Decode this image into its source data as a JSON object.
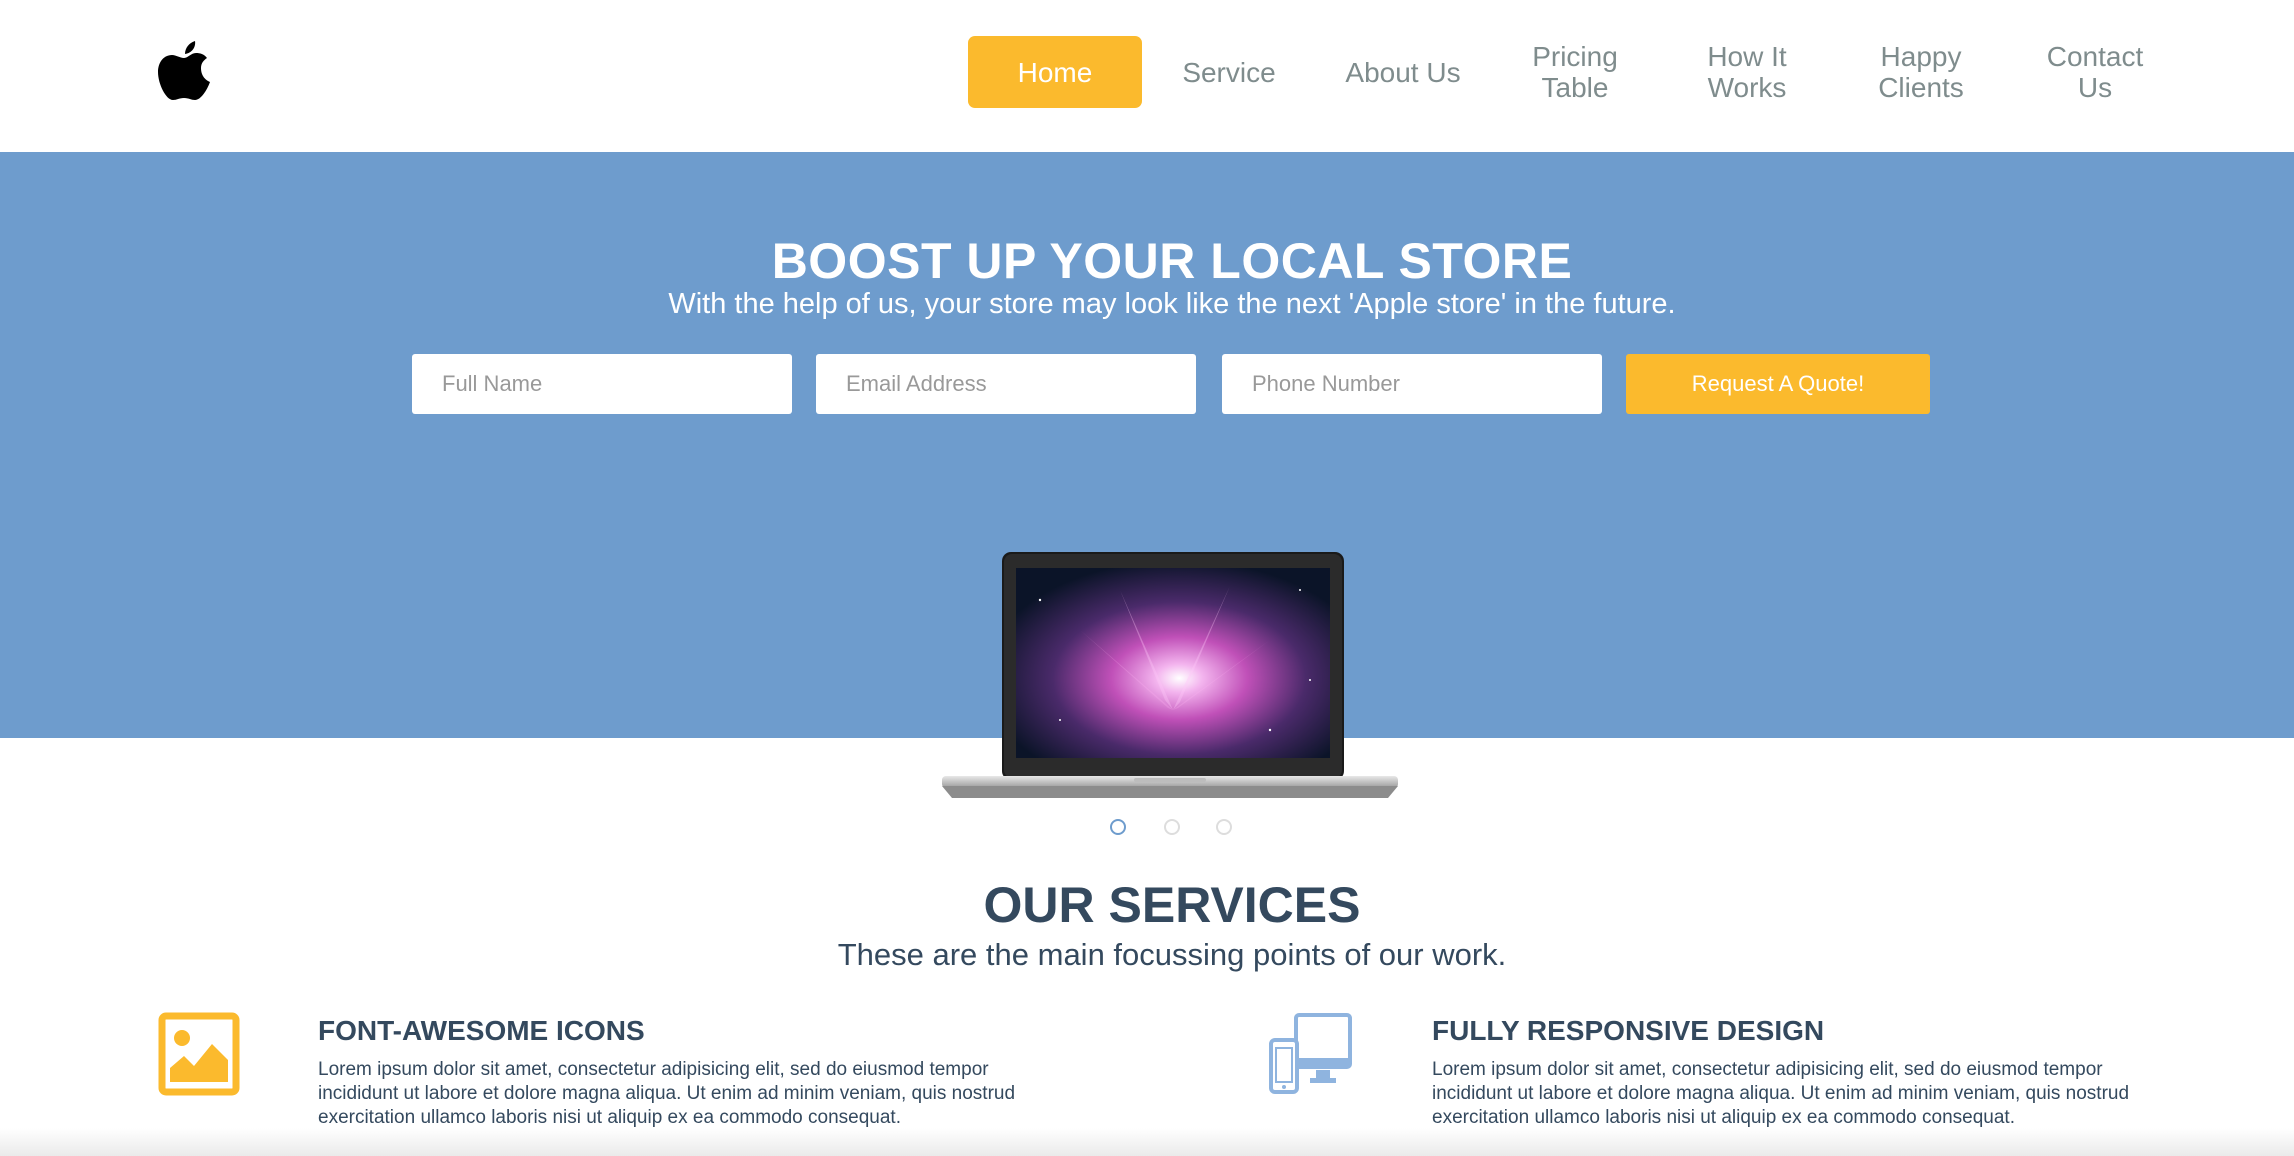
{
  "header": {
    "logo_icon": "apple-logo-icon",
    "nav": [
      {
        "label": "Home",
        "active": true
      },
      {
        "label": "Service",
        "active": false
      },
      {
        "label": "About Us",
        "active": false
      },
      {
        "label": "Pricing Table",
        "active": false
      },
      {
        "label": "How It Works",
        "active": false
      },
      {
        "label": "Happy Clients",
        "active": false
      },
      {
        "label": "Contact Us",
        "active": false
      }
    ]
  },
  "hero": {
    "title": "BOOST UP YOUR LOCAL STORE",
    "subtitle": "With the help of us, your store may look like the next 'Apple store' in the future.",
    "form": {
      "name_placeholder": "Full Name",
      "email_placeholder": "Email Address",
      "phone_placeholder": "Phone Number",
      "submit_label": "Request A Quote!"
    },
    "slider": {
      "slide_count": 3,
      "active_index": 0
    }
  },
  "services": {
    "title": "OUR SERVICES",
    "subtitle": "These are the main focussing points of our work.",
    "features": [
      {
        "icon": "image-icon",
        "title": "FONT-AWESOME ICONS",
        "text": "Lorem ipsum dolor sit amet, consectetur adipisicing elit, sed do eiusmod tempor incididunt ut labore et dolore magna aliqua. Ut enim ad minim veniam, quis nostrud exercitation ullamco laboris nisi ut aliquip ex ea commodo consequat."
      },
      {
        "icon": "devices-icon",
        "title": "FULLY RESPONSIVE DESIGN",
        "text": "Lorem ipsum dolor sit amet, consectetur adipisicing elit, sed do eiusmod tempor incididunt ut labore et dolore magna aliqua. Ut enim ad minim veniam, quis nostrud exercitation ullamco laboris nisi ut aliquip ex ea commodo consequat."
      }
    ]
  },
  "colors": {
    "accent": "#fbba2d",
    "hero_bg": "#6e9ccd",
    "heading": "#34495e",
    "nav_text": "#7f8c8d"
  }
}
